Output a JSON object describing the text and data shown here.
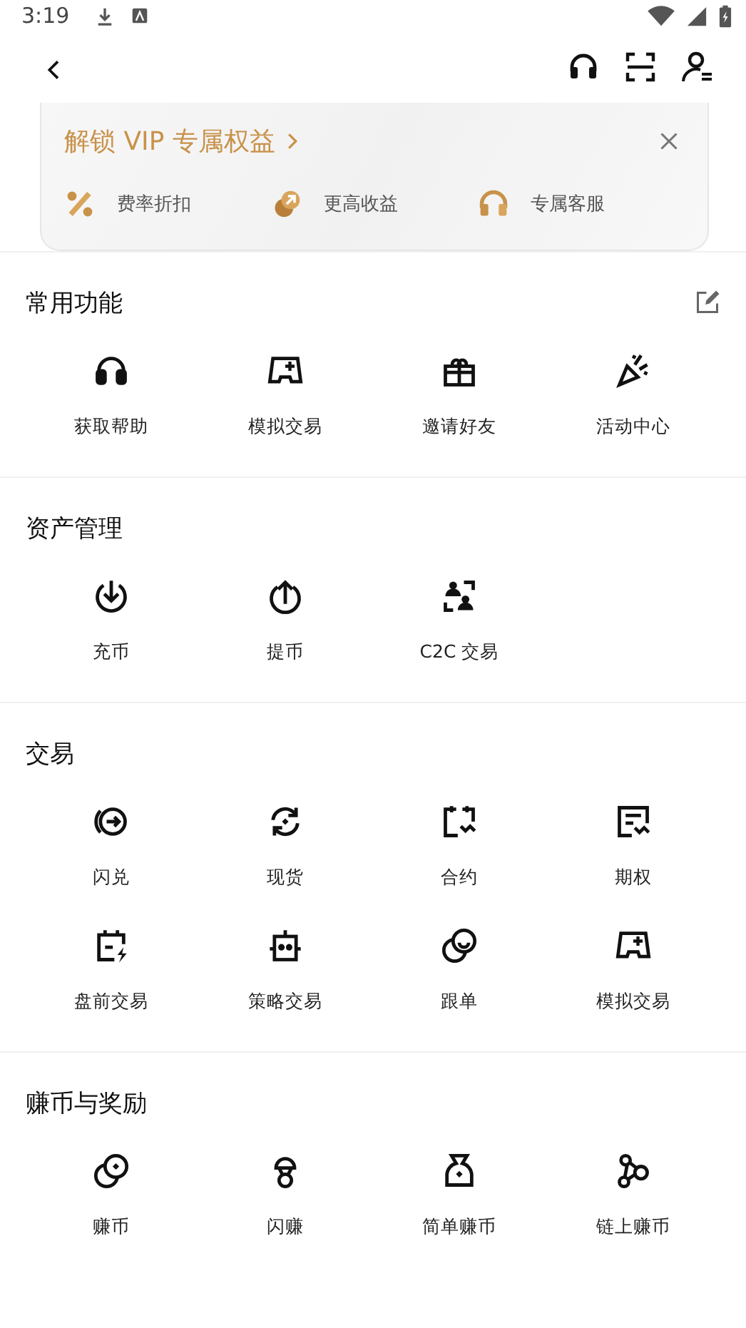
{
  "status_bar": {
    "time": "3:19"
  },
  "vip_card": {
    "title": "解锁 VIP 专属权益",
    "benefits": [
      "费率折扣",
      "更高收益",
      "专属客服"
    ]
  },
  "sections": [
    {
      "title": "常用功能",
      "editable": true,
      "items": [
        "获取帮助",
        "模拟交易",
        "邀请好友",
        "活动中心"
      ]
    },
    {
      "title": "资产管理",
      "editable": false,
      "items": [
        "充币",
        "提币",
        "C2C 交易"
      ]
    },
    {
      "title": "交易",
      "editable": false,
      "items": [
        "闪兑",
        "现货",
        "合约",
        "期权",
        "盘前交易",
        "策略交易",
        "跟单",
        "模拟交易"
      ]
    },
    {
      "title": "赚币与奖励",
      "editable": false,
      "items": [
        "赚币",
        "闪赚",
        "简单赚币",
        "链上赚币"
      ]
    }
  ]
}
